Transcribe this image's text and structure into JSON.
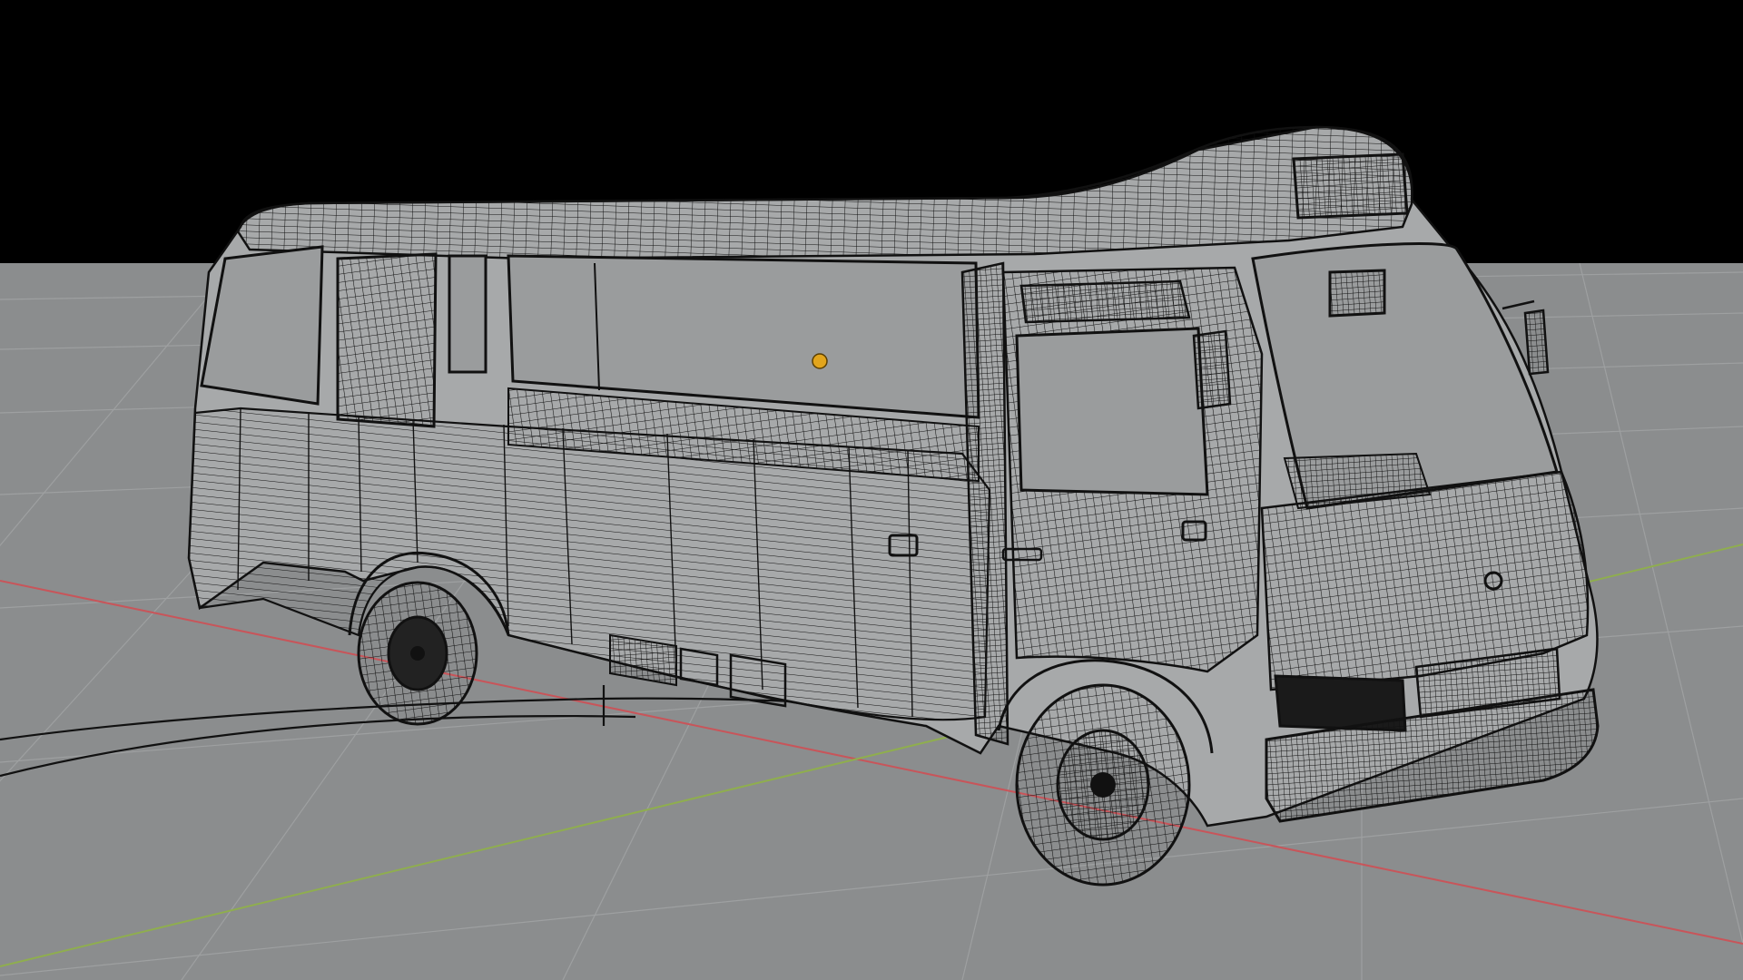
{
  "viewport": {
    "background_color": "#000000",
    "ground_color": "#8b8d8e",
    "grid_line_color": "#9ea0a1",
    "x_axis_color": "#c8555a",
    "y_axis_color": "#8fae4e",
    "wire_color": "#111111",
    "body_fill": "#a7a9aa",
    "glass_fill": "#9a9c9d",
    "origin_marker_color": "#e2a51d"
  },
  "scene": {
    "object": "bus-wireframe-mesh",
    "shading_mode": "wireframe-overlay"
  }
}
